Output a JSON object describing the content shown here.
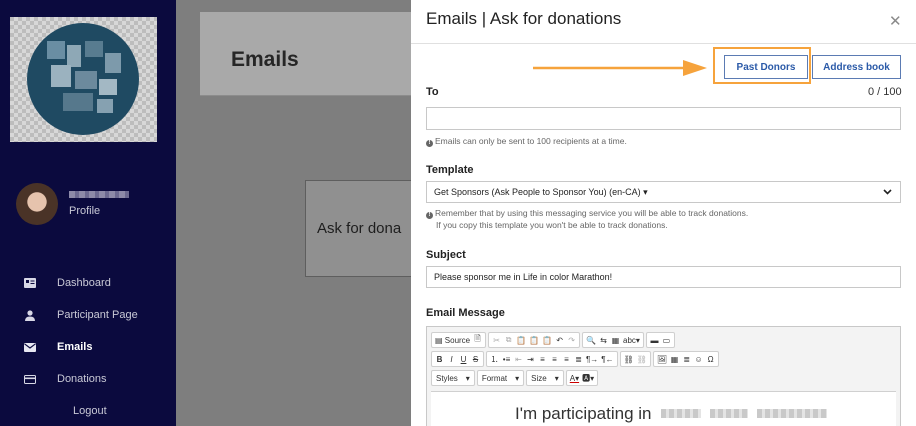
{
  "sidebar": {
    "profile_label": "Profile",
    "nav": [
      {
        "label": "Dashboard",
        "icon": "id-card-icon",
        "active": false
      },
      {
        "label": "Participant Page",
        "icon": "person-icon",
        "active": false
      },
      {
        "label": "Emails",
        "icon": "envelope-icon",
        "active": true
      },
      {
        "label": "Donations",
        "icon": "credit-card-icon",
        "active": false
      }
    ],
    "logout_label": "Logout"
  },
  "background": {
    "page_title": "Emails",
    "card_text": "Ask for dona"
  },
  "panel": {
    "title": "Emails | Ask for donations",
    "past_donors_label": "Past Donors",
    "address_book_label": "Address book",
    "to_label": "To",
    "to_counter": "0 / 100",
    "to_value": "",
    "to_hint": "Emails can only be sent to 100 recipients at a time.",
    "template_label": "Template",
    "template_value": "Get Sponsors (Ask People to Sponsor You) (en-CA) ▾",
    "template_hint_1": "Remember that by using this messaging service you will be able to track donations.",
    "template_hint_2": "If you copy this template you won't be able to track donations.",
    "subject_label": "Subject",
    "subject_value": "Please sponsor me in Life in color  Marathon!",
    "message_label": "Email Message",
    "editor": {
      "source_label": "Source",
      "styles_label": "Styles",
      "format_label": "Format",
      "size_label": "Size",
      "body_text": "I'm participating in"
    }
  },
  "colors": {
    "sidebar_bg": "#0b0a3e",
    "highlight": "#f6a33c",
    "button_text": "#2b5aa8"
  }
}
